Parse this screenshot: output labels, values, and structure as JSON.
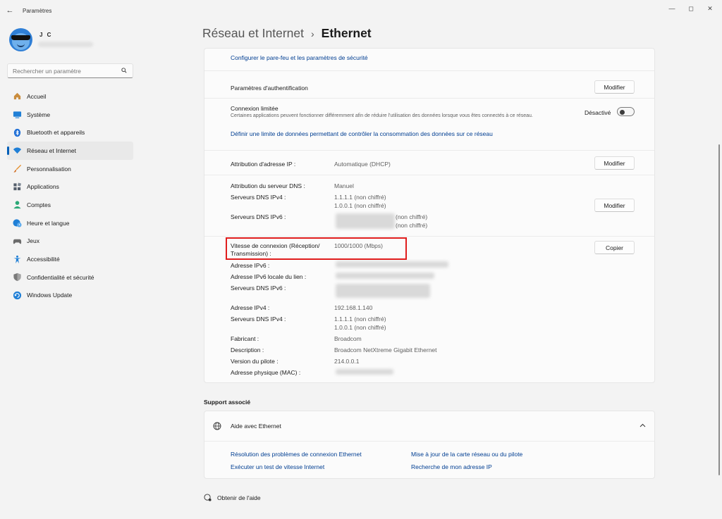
{
  "window": {
    "title": "Paramètres",
    "controls": [
      "—",
      "◻",
      "✕"
    ]
  },
  "user": {
    "name": "J C"
  },
  "search": {
    "placeholder": "Rechercher un paramètre"
  },
  "sidebar": {
    "items": [
      {
        "label": "Accueil",
        "icon": "home-icon",
        "color": "#c98c3d"
      },
      {
        "label": "Système",
        "icon": "display-icon",
        "color": "#1f7fd6"
      },
      {
        "label": "Bluetooth et appareils",
        "icon": "bluetooth-icon",
        "color": "#1f6fd6"
      },
      {
        "label": "Réseau et Internet",
        "icon": "wifi-icon",
        "color": "#1f7fd6",
        "active": true
      },
      {
        "label": "Personnalisation",
        "icon": "brush-icon",
        "color": "#e58d2a"
      },
      {
        "label": "Applications",
        "icon": "apps-icon",
        "color": "#555e6b"
      },
      {
        "label": "Comptes",
        "icon": "person-icon",
        "color": "#2aa876"
      },
      {
        "label": "Heure et langue",
        "icon": "globe-clock-icon",
        "color": "#1f7fd6"
      },
      {
        "label": "Jeux",
        "icon": "gamepad-icon",
        "color": "#6b6b6b"
      },
      {
        "label": "Accessibilité",
        "icon": "accessibility-icon",
        "color": "#1f7fd6"
      },
      {
        "label": "Confidentialité et sécurité",
        "icon": "shield-icon",
        "color": "#6b6b6b"
      },
      {
        "label": "Windows Update",
        "icon": "update-icon",
        "color": "#1f7fd6"
      }
    ]
  },
  "breadcrumb": {
    "parent": "Réseau et Internet",
    "separator": "›",
    "current": "Ethernet"
  },
  "main": {
    "firewall_link": "Configurer le pare-feu et les paramètres de sécurité",
    "auth": {
      "label": "Paramètres d'authentification",
      "button": "Modifier"
    },
    "metered": {
      "label": "Connexion limitée",
      "description": "Certaines applications peuvent fonctionner différemment afin de réduire l'utilisation des données lorsque vous êtes connectés à ce réseau.",
      "state": "Désactivé",
      "link": "Définir une limite de données permettant de contrôler la consommation des données sur ce réseau"
    },
    "ip_assignment": {
      "label": "Attribution d'adresse IP :",
      "value": "Automatique (DHCP)",
      "button": "Modifier"
    },
    "dns": {
      "assign_label": "Attribution du serveur DNS :",
      "assign_value": "Manuel",
      "ipv4_label": "Serveurs DNS IPv4 :",
      "ipv4_values": [
        "1.1.1.1 (non chiffré)",
        "1.0.0.1 (non chiffré)"
      ],
      "ipv6_label": "Serveurs DNS IPv6 :",
      "ipv6_values": [
        "(non chiffré)",
        "(non chiffré)"
      ],
      "button": "Modifier"
    },
    "properties": {
      "speed_label": "Vitesse de connexion (Réception/ Transmission) :",
      "speed_value": "1000/1000 (Mbps)",
      "copy_button": "Copier",
      "ipv6_label": "Adresse IPv6 :",
      "ipv6_link_local_label": "Adresse IPv6 locale du lien :",
      "dns_ipv6_label": "Serveurs DNS IPv6 :",
      "ipv4_label": "Adresse IPv4 :",
      "ipv4_value": "192.168.1.140",
      "dns_ipv4_label": "Serveurs DNS IPv4 :",
      "dns_ipv4_values": [
        "1.1.1.1 (non chiffré)",
        "1.0.0.1 (non chiffré)"
      ],
      "manufacturer_label": "Fabricant :",
      "manufacturer_value": "Broadcom",
      "description_label": "Description :",
      "description_value": "Broadcom NetXtreme Gigabit Ethernet",
      "driver_label": "Version du pilote :",
      "driver_value": "214.0.0.1",
      "mac_label": "Adresse physique (MAC) :"
    }
  },
  "support": {
    "title": "Support associé",
    "card_title": "Aide avec Ethernet",
    "links": [
      "Résolution des problèmes de connexion Ethernet",
      "Mise à jour de la carte réseau ou du pilote",
      "Exécuter un test de vitesse Internet",
      "Recherche de mon adresse IP"
    ]
  },
  "help": {
    "label": "Obtenir de l'aide"
  },
  "colors": {
    "accent": "#005fb8",
    "link": "#003e92",
    "highlight": "#e01d1d"
  }
}
